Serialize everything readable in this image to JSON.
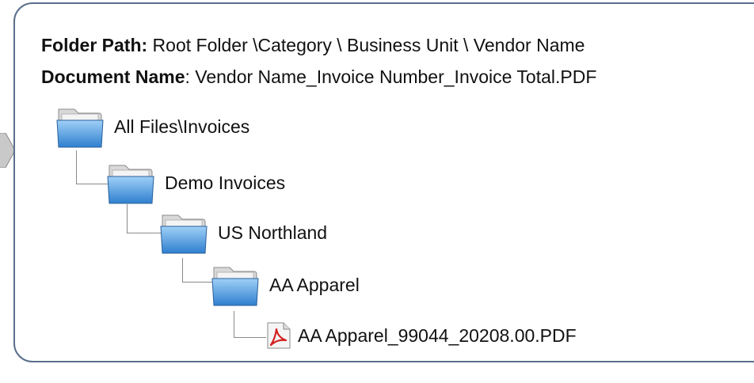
{
  "header": {
    "folder_path_label": "Folder Path:",
    "folder_path_value": " Root Folder \\Category \\ Business Unit \\ Vendor Name",
    "document_name_label": "Document Name",
    "document_name_value": ": Vendor Name_Invoice Number_Invoice Total.PDF"
  },
  "tree": {
    "level0": {
      "label": "All Files\\Invoices",
      "icon": "folder-icon"
    },
    "level1": {
      "label": "Demo Invoices",
      "icon": "folder-icon"
    },
    "level2": {
      "label": "US Northland",
      "icon": "folder-icon"
    },
    "level3": {
      "label": "AA Apparel",
      "icon": "folder-icon"
    },
    "level4": {
      "label": "AA Apparel_99044_20208.00.PDF",
      "icon": "pdf-icon"
    }
  },
  "colors": {
    "border": "#5a6f8c",
    "folder_blue": "#3f8fd6",
    "pdf_red": "#d42020"
  }
}
